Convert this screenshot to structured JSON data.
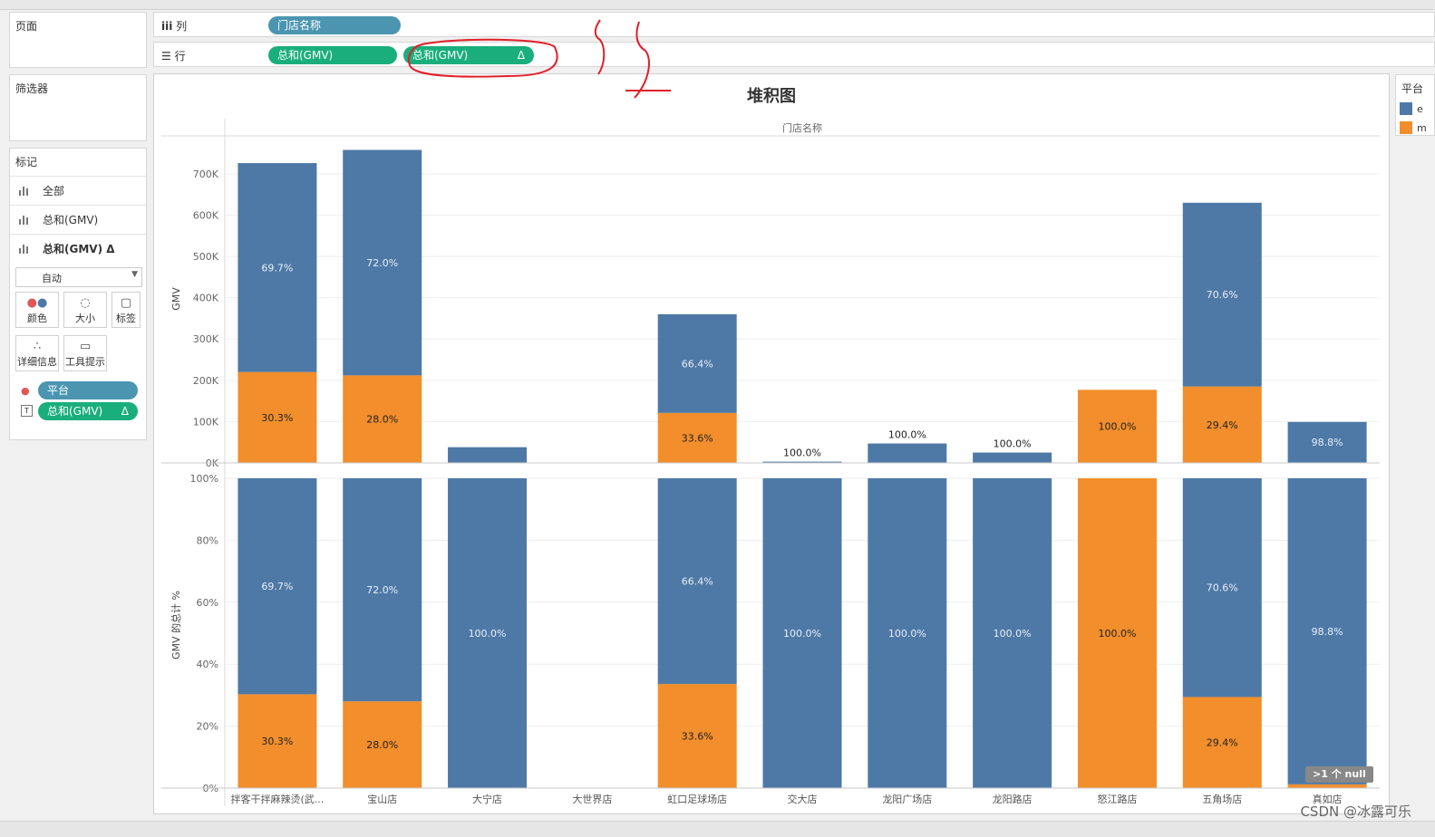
{
  "shelves": {
    "pages_label": "页面",
    "filters_label": "筛选器",
    "columns_label": "列",
    "rows_label": "行",
    "column_pill": "门店名称",
    "row_pill_1": "总和(GMV)",
    "row_pill_2": "总和(GMV)",
    "delta_symbol": "Δ"
  },
  "marks": {
    "title": "标记",
    "rows": [
      {
        "label": "全部"
      },
      {
        "label": "总和(GMV)"
      },
      {
        "label": "总和(GMV) Δ"
      }
    ],
    "mark_type": "自动",
    "cards": [
      {
        "label": "颜色",
        "icon": "color-dots-icon"
      },
      {
        "label": "大小",
        "icon": "size-icon"
      },
      {
        "label": "标签",
        "icon": "label-icon"
      },
      {
        "label": "详细信息",
        "icon": "detail-icon"
      },
      {
        "label": "工具提示",
        "icon": "tooltip-icon"
      }
    ],
    "field_pills": [
      {
        "label": "平台",
        "color": "#4b95b1"
      },
      {
        "label": "总和(GMV)",
        "color": "#1aae7d",
        "suffix": "Δ"
      }
    ]
  },
  "legend": {
    "title": "平台",
    "items": [
      {
        "label": "e",
        "color": "#4e79a7"
      },
      {
        "label": "m",
        "color": "#f28e2b"
      }
    ]
  },
  "annotation": {
    "handwriting": "5 5",
    "color": "#e0202a"
  },
  "null_badge": ">1 个 null",
  "watermark": "CSDN @冰露可乐",
  "chart_data": {
    "type": "bar",
    "title": "堆积图",
    "header_label": "门店名称",
    "categories": [
      "拌客干拌麻辣烫(武...",
      "宝山店",
      "大宁店",
      "大世界店",
      "虹口足球场店",
      "交大店",
      "龙阳广场店",
      "龙阳路店",
      "怒江路店",
      "五角场店",
      "真如店"
    ],
    "colors": {
      "e": "#4e79a7",
      "m": "#f28e2b"
    },
    "top_panel": {
      "ylabel": "GMV",
      "ylim": [
        0,
        770000
      ],
      "ticks": [
        0,
        100000,
        200000,
        300000,
        400000,
        500000,
        600000,
        700000
      ],
      "tick_labels": [
        "0K",
        "100K",
        "200K",
        "300K",
        "400K",
        "500K",
        "600K",
        "700K"
      ],
      "series": [
        {
          "values": [
            506000,
            546000,
            38000,
            0,
            239000,
            3000,
            47000,
            25000,
            0,
            445000,
            98000
          ],
          "labels": [
            "69.7%",
            "72.0%",
            "",
            "",
            "66.4%",
            "100.0%",
            "100.0%",
            "100.0%",
            "",
            "70.6%",
            "98.8%"
          ]
        },
        {
          "values": [
            220000,
            212000,
            0,
            0,
            121000,
            0,
            0,
            0,
            177000,
            185000,
            1200
          ],
          "labels": [
            "30.3%",
            "28.0%",
            "",
            "",
            "33.6%",
            "",
            "",
            "",
            "100.0%",
            "29.4%",
            ""
          ]
        }
      ]
    },
    "bottom_panel": {
      "ylabel": "GMV 的总计 %",
      "ylim": [
        0,
        100
      ],
      "ticks": [
        0,
        20,
        40,
        60,
        80,
        100
      ],
      "tick_labels": [
        "0%",
        "20%",
        "40%",
        "60%",
        "80%",
        "100%"
      ],
      "series": [
        {
          "values": [
            69.7,
            72.0,
            100.0,
            0,
            66.4,
            100.0,
            100.0,
            100.0,
            0,
            70.6,
            98.8
          ],
          "labels": [
            "69.7%",
            "72.0%",
            "100.0%",
            "",
            "66.4%",
            "100.0%",
            "100.0%",
            "100.0%",
            "",
            "70.6%",
            "98.8%"
          ]
        },
        {
          "values": [
            30.3,
            28.0,
            0,
            0,
            33.6,
            0,
            0,
            0,
            100.0,
            29.4,
            1.2
          ],
          "labels": [
            "30.3%",
            "28.0%",
            "",
            "",
            "33.6%",
            "",
            "",
            "",
            "100.0%",
            "29.4%",
            ""
          ]
        }
      ]
    }
  }
}
